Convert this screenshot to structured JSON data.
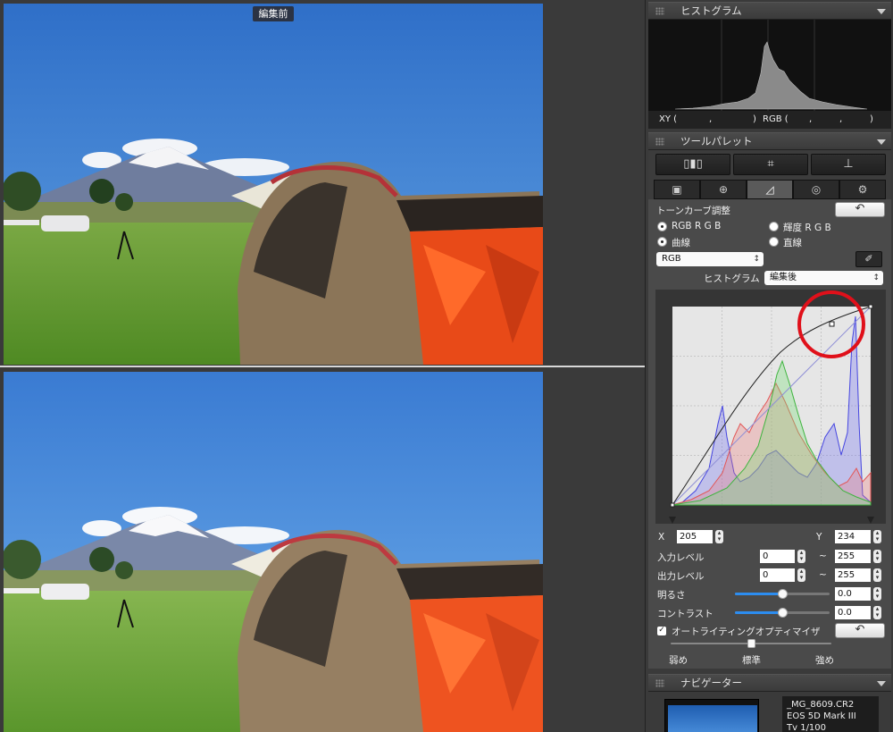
{
  "viewer": {
    "before_badge": "編集前"
  },
  "panels": {
    "histogram": {
      "title": "ヒストグラム"
    },
    "xy_label": "XY (",
    "xy_comma": ",",
    "xy_close": ")",
    "rgb_label": "RGB (",
    "rgb_comma1": ",",
    "rgb_comma2": ",",
    "rgb_close": ")",
    "tool_palette": {
      "title": "ツールパレット"
    },
    "navigator": {
      "title": "ナビゲーター"
    }
  },
  "tool_palette": {
    "tools": [
      "▯▮▯",
      "⌗",
      "⊥"
    ],
    "tabs": [
      "▣",
      "⊕",
      "◿",
      "◎",
      "⚙"
    ],
    "active_tab": 2,
    "section_title": "トーンカーブ調整",
    "radio_rgb": "RGB R G B",
    "radio_luma": "輝度 R G B",
    "radio_curve": "曲線",
    "radio_line": "直線",
    "channel_select": "RGB",
    "histogram_label": "ヒストグラム",
    "histogram_select": "編集後",
    "x_label": "X",
    "x_value": "205",
    "y_label": "Y",
    "y_value": "234",
    "input_level_label": "入力レベル",
    "input_level_min": "0",
    "input_level_max": "255",
    "output_level_label": "出力レベル",
    "output_level_min": "0",
    "output_level_max": "255",
    "tilde": "~",
    "brightness_label": "明るさ",
    "brightness_value": "0.0",
    "brightness_level": 0.5,
    "contrast_label": "コントラスト",
    "contrast_value": "0.0",
    "contrast_level": 0.5,
    "alo_label": "オートライティングオプティマイザ",
    "alo_checked": true,
    "alo_weak": "弱め",
    "alo_standard": "標準",
    "alo_strong": "強め",
    "alo_level": 0.5
  },
  "navigator": {
    "filename": "_MG_8609.CR2",
    "camera": "EOS 5D Mark III",
    "shutter": "Tv 1/100"
  },
  "colors": {
    "curve_highlight": "#e0101a",
    "slider_fill": "#2c8df0"
  }
}
